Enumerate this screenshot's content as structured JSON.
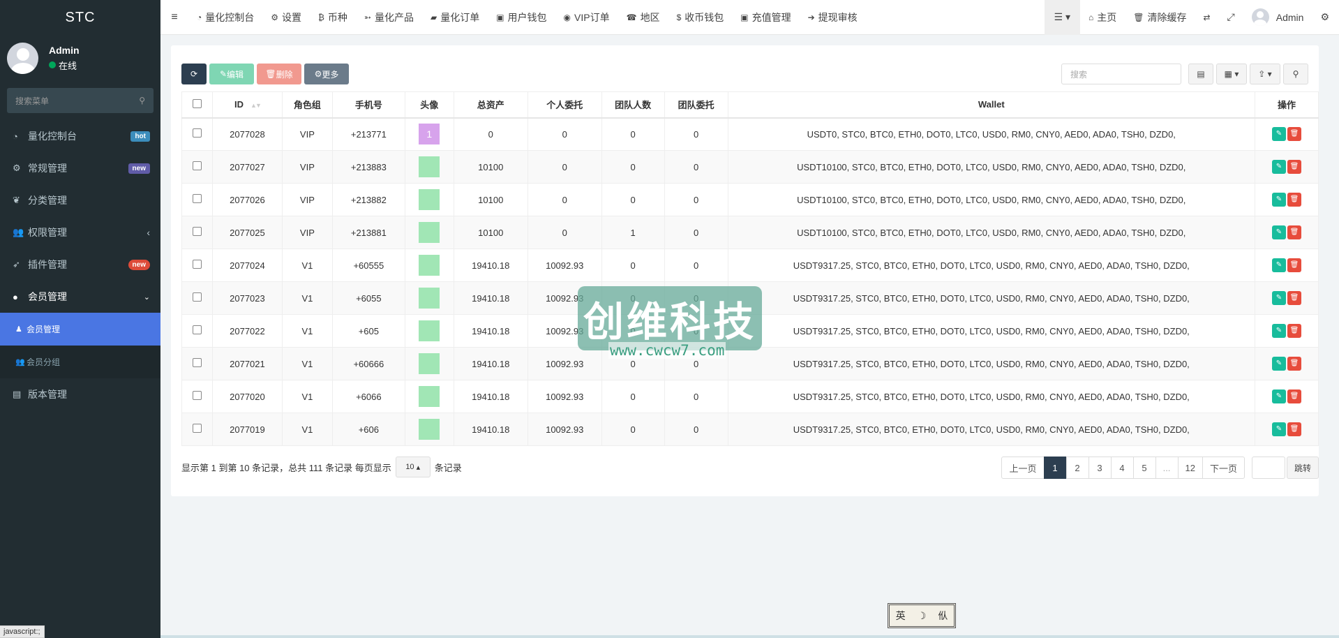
{
  "brand": "STC",
  "user": {
    "name": "Admin",
    "status": "在线"
  },
  "sidebar": {
    "search_placeholder": "搜索菜单",
    "items": [
      {
        "label": "量化控制台",
        "icon": "dashboard-icon",
        "badge": "hot"
      },
      {
        "label": "常规管理",
        "icon": "cogs-icon",
        "badge": "new"
      },
      {
        "label": "分类管理",
        "icon": "leaf-icon",
        "badge": ""
      },
      {
        "label": "权限管理",
        "icon": "group-icon",
        "badge": ""
      },
      {
        "label": "插件管理",
        "icon": "rocket-icon",
        "badge": "new"
      },
      {
        "label": "会员管理",
        "icon": "user-circle-icon",
        "badge": ""
      },
      {
        "label": "版本管理",
        "icon": "file-icon",
        "badge": ""
      }
    ],
    "subitems": [
      {
        "label": "会员管理",
        "icon": "user-icon"
      },
      {
        "label": "会员分组",
        "icon": "users-icon"
      }
    ]
  },
  "navbar": {
    "links": [
      {
        "label": "量化控制台",
        "icon": "dashboard-icon"
      },
      {
        "label": "设置",
        "icon": "gear-icon"
      },
      {
        "label": "币种",
        "icon": "bitcoin-icon"
      },
      {
        "label": "量化产品",
        "icon": "product-icon"
      },
      {
        "label": "量化订单",
        "icon": "book-icon"
      },
      {
        "label": "用户钱包",
        "icon": "money-icon"
      },
      {
        "label": "VIP订单",
        "icon": "vip-icon"
      },
      {
        "label": "地区",
        "icon": "phone-square-icon"
      },
      {
        "label": "收币钱包",
        "icon": "dollar-icon"
      },
      {
        "label": "充值管理",
        "icon": "money-icon"
      },
      {
        "label": "提现审核",
        "icon": "arrow-circle-icon"
      }
    ],
    "home": "主页",
    "clear_cache": "清除缓存",
    "admin": "Admin"
  },
  "toolbar": {
    "edit": "编辑",
    "delete": "删除",
    "more": "更多",
    "search_placeholder": "搜索"
  },
  "table": {
    "headers": [
      "ID",
      "角色组",
      "手机号",
      "头像",
      "总资产",
      "个人委托",
      "团队人数",
      "团队委托",
      "Wallet",
      "操作"
    ],
    "rows": [
      {
        "id": "2077028",
        "role": "VIP",
        "phone": "+213771",
        "avatar": "1",
        "total": "0",
        "personal": "0",
        "team_count": "0",
        "team_entrust": "0",
        "wallet": "USDT0, STC0, BTC0, ETH0, DOT0, LTC0, USD0, RM0, CNY0, AED0, ADA0, TSH0, DZD0,"
      },
      {
        "id": "2077027",
        "role": "VIP",
        "phone": "+213883",
        "avatar": "",
        "total": "10100",
        "personal": "0",
        "team_count": "0",
        "team_entrust": "0",
        "wallet": "USDT10100, STC0, BTC0, ETH0, DOT0, LTC0, USD0, RM0, CNY0, AED0, ADA0, TSH0, DZD0,"
      },
      {
        "id": "2077026",
        "role": "VIP",
        "phone": "+213882",
        "avatar": "",
        "total": "10100",
        "personal": "0",
        "team_count": "0",
        "team_entrust": "0",
        "wallet": "USDT10100, STC0, BTC0, ETH0, DOT0, LTC0, USD0, RM0, CNY0, AED0, ADA0, TSH0, DZD0,"
      },
      {
        "id": "2077025",
        "role": "VIP",
        "phone": "+213881",
        "avatar": "",
        "total": "10100",
        "personal": "0",
        "team_count": "1",
        "team_entrust": "0",
        "wallet": "USDT10100, STC0, BTC0, ETH0, DOT0, LTC0, USD0, RM0, CNY0, AED0, ADA0, TSH0, DZD0,"
      },
      {
        "id": "2077024",
        "role": "V1",
        "phone": "+60555",
        "avatar": "",
        "total": "19410.18",
        "personal": "10092.93",
        "team_count": "0",
        "team_entrust": "0",
        "wallet": "USDT9317.25, STC0, BTC0, ETH0, DOT0, LTC0, USD0, RM0, CNY0, AED0, ADA0, TSH0, DZD0,"
      },
      {
        "id": "2077023",
        "role": "V1",
        "phone": "+6055",
        "avatar": "",
        "total": "19410.18",
        "personal": "10092.93",
        "team_count": "0",
        "team_entrust": "0",
        "wallet": "USDT9317.25, STC0, BTC0, ETH0, DOT0, LTC0, USD0, RM0, CNY0, AED0, ADA0, TSH0, DZD0,"
      },
      {
        "id": "2077022",
        "role": "V1",
        "phone": "+605",
        "avatar": "",
        "total": "19410.18",
        "personal": "10092.93",
        "team_count": "0",
        "team_entrust": "0",
        "wallet": "USDT9317.25, STC0, BTC0, ETH0, DOT0, LTC0, USD0, RM0, CNY0, AED0, ADA0, TSH0, DZD0,"
      },
      {
        "id": "2077021",
        "role": "V1",
        "phone": "+60666",
        "avatar": "",
        "total": "19410.18",
        "personal": "10092.93",
        "team_count": "0",
        "team_entrust": "0",
        "wallet": "USDT9317.25, STC0, BTC0, ETH0, DOT0, LTC0, USD0, RM0, CNY0, AED0, ADA0, TSH0, DZD0,"
      },
      {
        "id": "2077020",
        "role": "V1",
        "phone": "+6066",
        "avatar": "",
        "total": "19410.18",
        "personal": "10092.93",
        "team_count": "0",
        "team_entrust": "0",
        "wallet": "USDT9317.25, STC0, BTC0, ETH0, DOT0, LTC0, USD0, RM0, CNY0, AED0, ADA0, TSH0, DZD0,"
      },
      {
        "id": "2077019",
        "role": "V1",
        "phone": "+606",
        "avatar": "",
        "total": "19410.18",
        "personal": "10092.93",
        "team_count": "0",
        "team_entrust": "0",
        "wallet": "USDT9317.25, STC0, BTC0, ETH0, DOT0, LTC0, USD0, RM0, CNY0, AED0, ADA0, TSH0, DZD0,"
      }
    ]
  },
  "pager": {
    "info": "显示第 1 到第 10 条记录，总共 111 条记录 每页显示",
    "page_size": "10",
    "suffix": "条记录",
    "prev": "上一页",
    "pages": [
      "1",
      "2",
      "3",
      "4",
      "5",
      "...",
      "12"
    ],
    "next": "下一页",
    "jump": "跳转"
  },
  "watermark": {
    "title": "创维科技",
    "url": "www.cwcw7.com"
  },
  "ime": {
    "lang": "英",
    "moon": "☽",
    "mode": "㐺"
  },
  "status_hint": "javascript:;",
  "colors": {
    "sidebar_bg": "#222d32",
    "active_sub": "#4a76e3",
    "primary_dark": "#2c3e50",
    "success": "#18bc9c",
    "danger": "#e74c3c"
  }
}
